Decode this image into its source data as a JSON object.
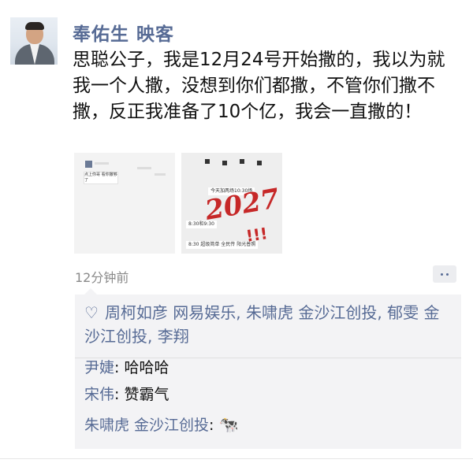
{
  "post": {
    "author": "奉佑生 映客",
    "text": "思聪公子，我是12月24号开始撒的，我以为就我一个人撒，没想到你们都撒，不管你们撒不撒，反正我准备了10个亿，我会一直撒的！",
    "images": [
      {
        "description": "chat screenshot",
        "bubble_text": "点上你哥 看你撒够了"
      },
      {
        "description": "handwritten note on chat screenshot",
        "messages": [
          "今天加两场10:30场",
          "8:30和9:30",
          "8:30 超级简单 全民传 阳光普照"
        ],
        "handwriting": "2027",
        "handwriting_marks": "!!!"
      }
    ],
    "timestamp": "12分钟前"
  },
  "icons": {
    "comment": "comment-dots-icon",
    "like": "heart-outline-icon",
    "cow": "cow-emoji"
  },
  "likes": {
    "text": "周柯如彦 网易娱乐, 朱啸虎 金沙江创投, 郁雯 金沙江创投, 李翔"
  },
  "comments": [
    {
      "name": "尹婕",
      "text": "哈哈哈"
    },
    {
      "name": "宋伟",
      "text": "赞霸气"
    },
    {
      "name": "朱啸虎 金沙江创投",
      "text": "🐄"
    }
  ],
  "colors": {
    "link": "#576b95",
    "panel": "#f3f3f5",
    "muted": "#8a8a8a"
  }
}
